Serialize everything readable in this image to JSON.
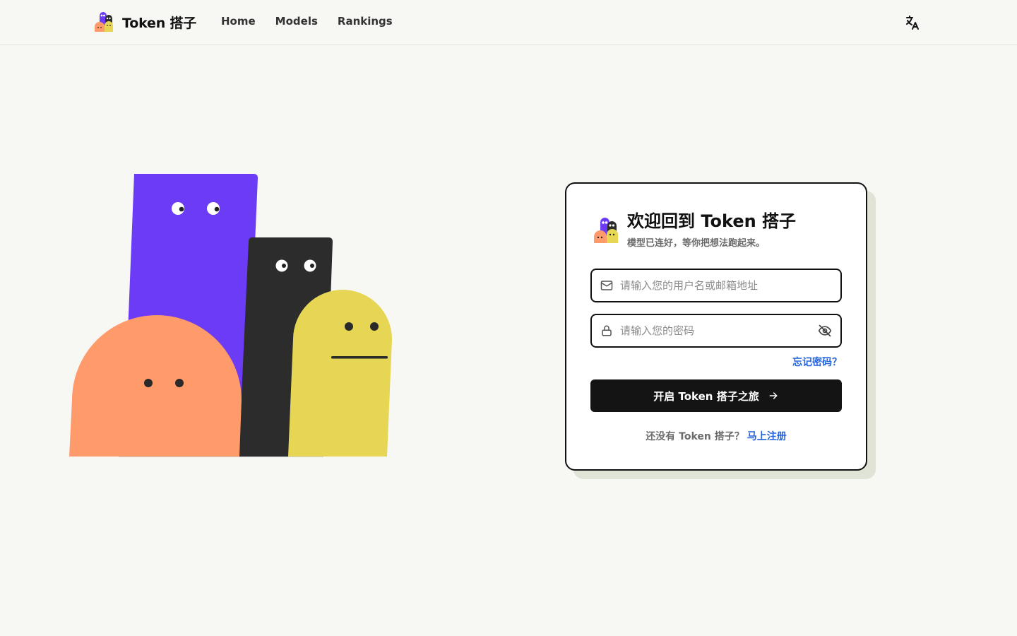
{
  "brand": {
    "name": "Token 搭子",
    "logo_icon": "token-mascots-logo"
  },
  "nav": {
    "items": [
      {
        "label": "Home"
      },
      {
        "label": "Models"
      },
      {
        "label": "Rankings"
      }
    ]
  },
  "header": {
    "language_icon": "translate-icon"
  },
  "login": {
    "title": "欢迎回到 Token 搭子",
    "subtitle": "模型已连好，等你把想法跑起来。",
    "username": {
      "placeholder": "请输入您的用户名或邮箱地址",
      "value": "",
      "icon": "mail-icon"
    },
    "password": {
      "placeholder": "请输入您的密码",
      "value": "",
      "icon": "lock-icon",
      "toggle_icon": "eye-off-icon"
    },
    "forgot_label": "忘记密码？",
    "submit_label": "开启 Token 搭子之旅",
    "register_prompt": "还没有 Token 搭子？",
    "register_link": "马上注册"
  },
  "colors": {
    "purple": "#6c3bf5",
    "dark": "#2c2c2c",
    "orange": "#ff9a6a",
    "yellow": "#e6d654",
    "link": "#2563d9",
    "button": "#141414",
    "shadow": "#dfe4d6"
  }
}
